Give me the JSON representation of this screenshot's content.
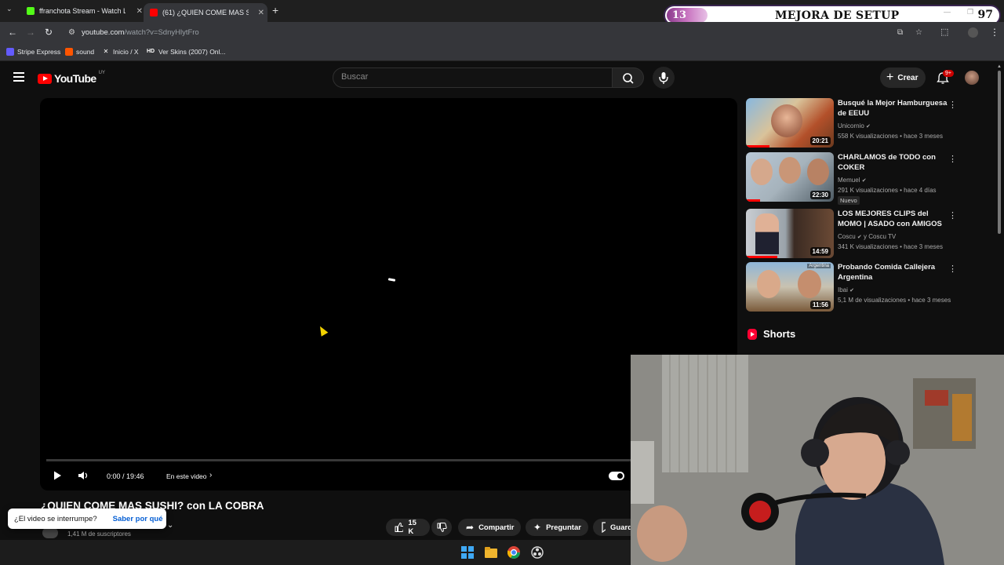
{
  "browser": {
    "tabs": [
      {
        "title": "ffranchota Stream - Watch Live",
        "favicon_color": "#53fc18"
      },
      {
        "title": "(61) ¿QUIEN COME MAS SUSHI?",
        "favicon_color": "#ff0000"
      }
    ],
    "url_host": "youtube.com",
    "url_path": "/watch?v=SdnyHlytFro",
    "bookmarks": [
      {
        "label": "Stripe Express",
        "icon": "stripe-icon"
      },
      {
        "label": "sound",
        "icon": "soundcloud-icon"
      },
      {
        "label": "Inicio / X",
        "icon": "x-icon"
      },
      {
        "label": "Ver Skins (2007) Onl...",
        "icon": "hd-icon",
        "icon_text": "HD"
      }
    ]
  },
  "overlay": {
    "level": "13",
    "title": "MEJORA DE SETUP",
    "number": "97"
  },
  "youtube": {
    "logo": "YouTube",
    "logo_country": "UY",
    "search_placeholder": "Buscar",
    "create_label": "Crear",
    "notifications_badge": "9+"
  },
  "player": {
    "time": "0:00 / 19:46",
    "chapters_label": "En este video"
  },
  "video": {
    "title": "¿QUIEN COME MAS SUSHI? con LA COBRA",
    "subscribers": "1,41 M de suscriptores",
    "likes": "15 K",
    "share_label": "Compartir",
    "ask_label": "Preguntar",
    "save_label": "Guard"
  },
  "popup": {
    "question": "¿El video se interrumpe?",
    "link": "Saber por qué"
  },
  "recommendations": [
    {
      "title": "Busqué la Mejor Hamburguesa de EEUU",
      "channel": "Unicornio",
      "meta": "558 K visualizaciones • hace 3 meses",
      "duration": "20:21",
      "badge": ""
    },
    {
      "title": "CHARLAMOS de TODO con COKER",
      "channel": "Memuel",
      "meta": "291 K visualizaciones • hace 4 días",
      "duration": "22:30",
      "badge": "Nuevo"
    },
    {
      "title": "LOS MEJORES CLIPS del MOMO | ASADO con AMIGOS",
      "channel": "Coscu",
      "channel_extra": "y Coscu TV",
      "meta": "341 K visualizaciones • hace 3 meses",
      "duration": "14:59",
      "badge": ""
    },
    {
      "title": "Probando Comida Callejera Argentina",
      "channel": "Ibai",
      "meta": "5,1 M de visualizaciones • hace 3 meses",
      "duration": "11:56",
      "badge": ""
    }
  ],
  "shorts_label": "Shorts",
  "thumb_caption_4": "Argentina",
  "colors": {
    "yt_red": "#ff0000",
    "background": "#0f0f0f",
    "link_blue": "#065fd4"
  }
}
